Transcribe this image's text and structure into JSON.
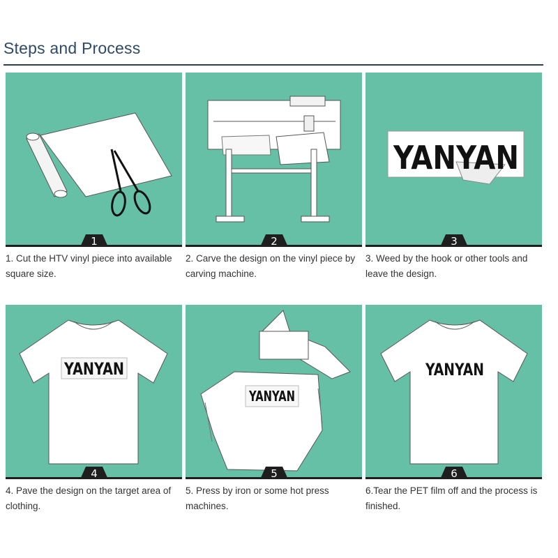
{
  "page": {
    "title": "Steps and Process"
  },
  "brand_text": "YANYAN",
  "steps": [
    {
      "number": "1",
      "caption": "1. Cut the HTV vinyl piece into available square size."
    },
    {
      "number": "2",
      "caption": "2. Carve the design on the vinyl piece by carving machine."
    },
    {
      "number": "3",
      "caption": "3. Weed by the hook or other tools and leave the design."
    },
    {
      "number": "4",
      "caption": "4. Pave the design on the target area of clothing."
    },
    {
      "number": "5",
      "caption": "5. Press by iron or some hot press machines."
    },
    {
      "number": "6",
      "caption": "6.Tear the PET film off and the process is finished."
    }
  ],
  "colors": {
    "panel": "#66c0a6",
    "title": "#2f4a64",
    "rule": "#2d3e50",
    "tab": "#1e1e1e"
  }
}
